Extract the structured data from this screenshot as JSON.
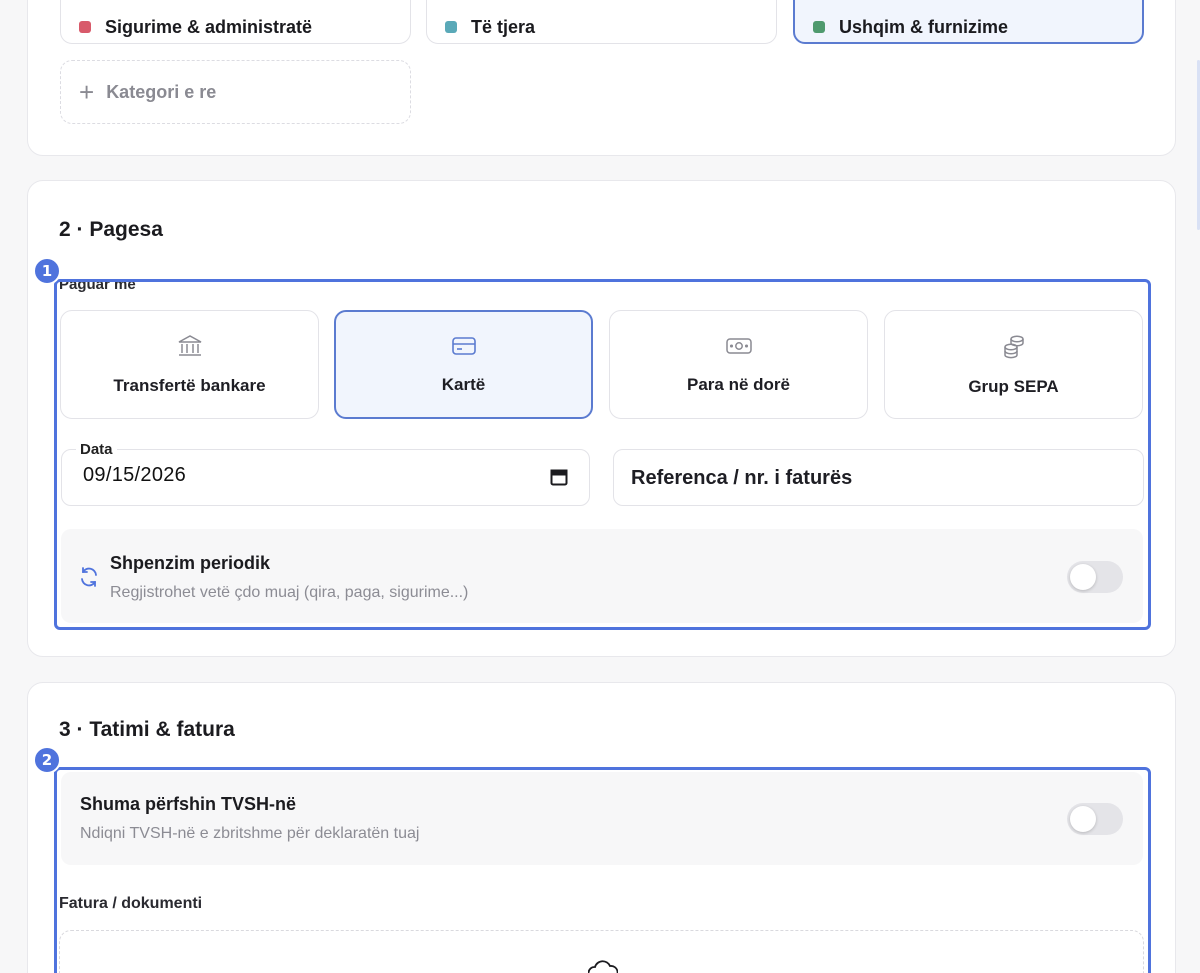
{
  "categories": {
    "items": [
      {
        "label": "Sigurime & administratë",
        "color": "#d85a6a",
        "selected": false
      },
      {
        "label": "Të tjera",
        "color": "#5aa9b8",
        "selected": false
      },
      {
        "label": "Ushqim & furnizime",
        "color": "#4f9a6e",
        "selected": true
      }
    ],
    "new_label": "Kategori e re"
  },
  "payment": {
    "section_title": "2 · Pagesa",
    "paid_with_label": "Paguar me",
    "methods": [
      {
        "label": "Transfertë bankare",
        "icon": "bank-icon",
        "selected": false
      },
      {
        "label": "Kartë",
        "icon": "card-icon",
        "selected": true
      },
      {
        "label": "Para në dorë",
        "icon": "cash-icon",
        "selected": false
      },
      {
        "label": "Grup SEPA",
        "icon": "coins-icon",
        "selected": false
      }
    ],
    "date_label": "Data",
    "date_value": "09/15/2026",
    "reference_placeholder": "Referenca / nr. i faturës",
    "recurring": {
      "title": "Shpenzim periodik",
      "subtitle": "Regjistrohet vetë çdo muaj (qira, paga, sigurime...)",
      "enabled": false
    }
  },
  "tax": {
    "section_title": "3 · Tatimi & fatura",
    "vat": {
      "title": "Shuma përfshin TVSH-në",
      "subtitle": "Ndiqni TVSH-në e zbritshme për deklaratën tuaj",
      "enabled": false
    },
    "invoice_label": "Fatura / dokumenti"
  },
  "annotations": {
    "badge_1": "1",
    "badge_2": "2"
  },
  "colors": {
    "accent": "#4f73dd",
    "selected_bg": "#f1f5fd",
    "selected_border": "#5b7bd0"
  }
}
